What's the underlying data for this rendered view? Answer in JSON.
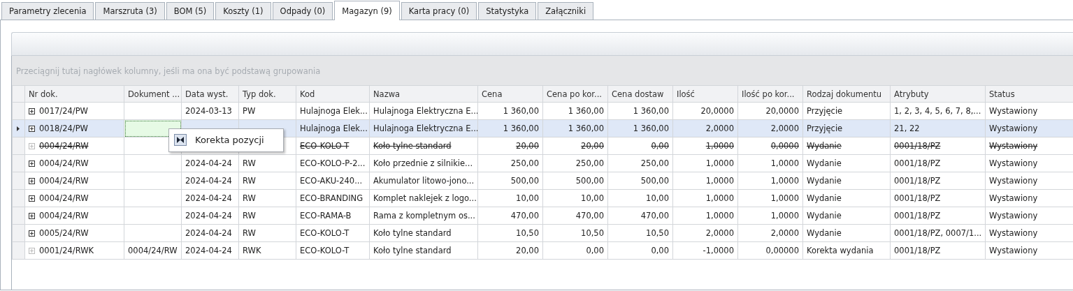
{
  "tabs": [
    {
      "label": "Parametry zlecenia",
      "selected": false
    },
    {
      "label": "Marszruta (3)",
      "selected": false
    },
    {
      "label": "BOM (5)",
      "selected": false
    },
    {
      "label": "Koszty (1)",
      "selected": false
    },
    {
      "label": "Odpady (0)",
      "selected": false
    },
    {
      "label": "Magazyn (9)",
      "selected": true
    },
    {
      "label": "Karta pracy (0)",
      "selected": false
    },
    {
      "label": "Statystyka",
      "selected": false
    },
    {
      "label": "Załączniki",
      "selected": false
    }
  ],
  "group_panel": {
    "placeholder": "Przeciągnij tutaj nagłówek kolumny, jeśli ma ona być podstawą grupowania"
  },
  "table": {
    "columns": [
      {
        "label": "Nr dok.",
        "kind": "text",
        "focused": false
      },
      {
        "label": "Dokument ...",
        "kind": "text",
        "focused": true
      },
      {
        "label": "Data wyst.",
        "kind": "text",
        "focused": false
      },
      {
        "label": "Typ dok.",
        "kind": "text",
        "focused": false
      },
      {
        "label": "Kod",
        "kind": "text",
        "focused": false
      },
      {
        "label": "Nazwa",
        "kind": "text",
        "focused": false
      },
      {
        "label": "Cena",
        "kind": "number",
        "focused": false
      },
      {
        "label": "Cena po kor...",
        "kind": "number",
        "focused": false
      },
      {
        "label": "Cena dostaw",
        "kind": "number",
        "focused": false
      },
      {
        "label": "Ilość",
        "kind": "number",
        "focused": false
      },
      {
        "label": "Ilość po kor...",
        "kind": "number",
        "focused": false
      },
      {
        "label": "Rodzaj dokumentu",
        "kind": "text",
        "focused": false
      },
      {
        "label": "Atrybuty",
        "kind": "text",
        "focused": false
      },
      {
        "label": "Status",
        "kind": "text",
        "focused": false
      }
    ],
    "rows": [
      {
        "selected": false,
        "cancelled": false,
        "expandable": true,
        "cells": [
          "0017/24/PW",
          "",
          "2024-03-13",
          "PW",
          "Hulajnoga Elek...",
          "Hulajnoga Elektryczna E...",
          "1 360,00",
          "1 360,00",
          "1 360,00",
          "20,0000",
          "20,0000",
          "Przyjęcie",
          "1, 2, 3, 4, 5, 6, 7, 8,...",
          "Wystawiony"
        ]
      },
      {
        "selected": true,
        "cancelled": false,
        "expandable": true,
        "cells": [
          "0018/24/PW",
          "",
          "",
          "",
          "Hulajnoga Elek...",
          "Hulajnoga Elektryczna E...",
          "1 360,00",
          "1 360,00",
          "1 360,00",
          "2,0000",
          "2,0000",
          "Przyjęcie",
          "21, 22",
          "Wystawiony"
        ]
      },
      {
        "selected": false,
        "cancelled": true,
        "expandable": false,
        "cells": [
          "0004/24/RW",
          "",
          "",
          "",
          "ECO-KOLO-T",
          "Koło tylne standard",
          "20,00",
          "20,00",
          "0,00",
          "1,0000",
          "0,0000",
          "Wydanie",
          "0001/18/PZ",
          "Wystawiony"
        ]
      },
      {
        "selected": false,
        "cancelled": false,
        "expandable": true,
        "cells": [
          "0004/24/RW",
          "",
          "2024-04-24",
          "RW",
          "ECO-KOLO-P-2...",
          "Koło przednie z silnikie...",
          "250,00",
          "250,00",
          "250,00",
          "1,0000",
          "1,0000",
          "Wydanie",
          "0001/18/PZ",
          "Wystawiony"
        ]
      },
      {
        "selected": false,
        "cancelled": false,
        "expandable": true,
        "cells": [
          "0004/24/RW",
          "",
          "2024-04-24",
          "RW",
          "ECO-AKU-240...",
          "Akumulator litowo-jono...",
          "500,00",
          "500,00",
          "500,00",
          "1,0000",
          "1,0000",
          "Wydanie",
          "0001/18/PZ",
          "Wystawiony"
        ]
      },
      {
        "selected": false,
        "cancelled": false,
        "expandable": true,
        "cells": [
          "0004/24/RW",
          "",
          "2024-04-24",
          "RW",
          "ECO-BRANDING",
          "Komplet naklejek z logo...",
          "10,00",
          "10,00",
          "10,00",
          "1,0000",
          "1,0000",
          "Wydanie",
          "0001/18/PZ",
          "Wystawiony"
        ]
      },
      {
        "selected": false,
        "cancelled": false,
        "expandable": true,
        "cells": [
          "0004/24/RW",
          "",
          "2024-04-24",
          "RW",
          "ECO-RAMA-B",
          "Rama z kompletnym os...",
          "470,00",
          "470,00",
          "470,00",
          "1,0000",
          "1,0000",
          "Wydanie",
          "0001/18/PZ",
          "Wystawiony"
        ]
      },
      {
        "selected": false,
        "cancelled": false,
        "expandable": true,
        "cells": [
          "0005/24/RW",
          "",
          "2024-04-24",
          "RW",
          "ECO-KOLO-T",
          "Koło tylne standard",
          "10,50",
          "10,50",
          "10,50",
          "2,0000",
          "2,0000",
          "Wydanie",
          "0001/18/PZ, 0007/1...",
          "Wystawiony"
        ]
      },
      {
        "selected": false,
        "cancelled": false,
        "expandable": false,
        "cells": [
          "0001/24/RWK",
          "0004/24/RW",
          "2024-04-24",
          "RWK",
          "ECO-KOLO-T",
          "Koło tylne standard",
          "20,00",
          "0,00",
          "0,00",
          "-1,0000",
          "0,00000",
          "Korekta wydania",
          "0001/18/PZ",
          "Wystawiony"
        ]
      }
    ]
  },
  "context_menu": {
    "items": [
      {
        "label": "Korekta pozycji"
      }
    ]
  }
}
